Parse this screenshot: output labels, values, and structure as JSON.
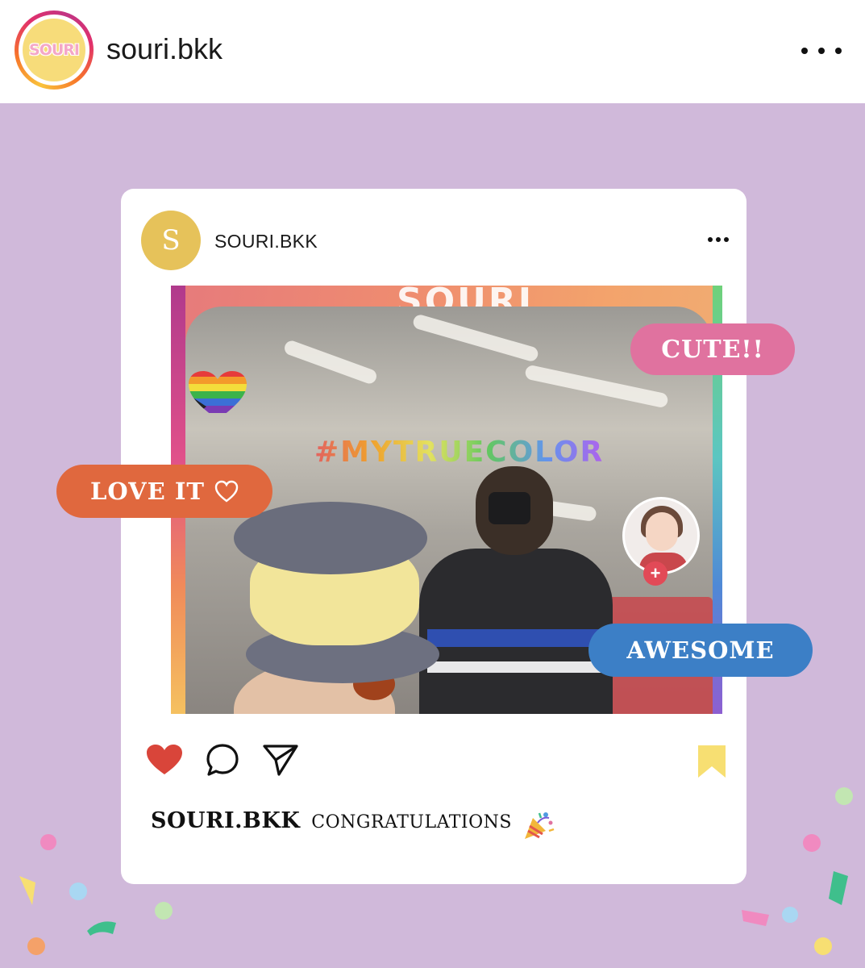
{
  "header": {
    "logo_text": "SOURI",
    "username": "souri.bkk",
    "more_icon": "more-horizontal-icon"
  },
  "card": {
    "avatar_letter": "S",
    "username": "SOURI.BKK",
    "more_icon": "more-horizontal-icon",
    "photo": {
      "sign_text": "SOURI",
      "neon_text": "#MYTRUECOLOR"
    },
    "actions": {
      "like_icon": "heart-filled-icon",
      "comment_icon": "comment-icon",
      "share_icon": "send-icon",
      "save_icon": "bookmark-icon"
    },
    "caption": {
      "user": "SOURI.BKK",
      "text": "CONGRATULATIONS",
      "emoji": "party-popper-icon"
    }
  },
  "stickers": {
    "cute": "CUTE!!",
    "love": "LOVE IT",
    "awesome": "AWESOME"
  },
  "colors": {
    "background": "#d0b9da",
    "like": "#d9453a",
    "bookmark": "#f7df72",
    "cute_pill": "#e0729f",
    "love_pill": "#e0683e",
    "awesome_pill": "#3c7fc6",
    "avatar": "#e6c25a"
  }
}
